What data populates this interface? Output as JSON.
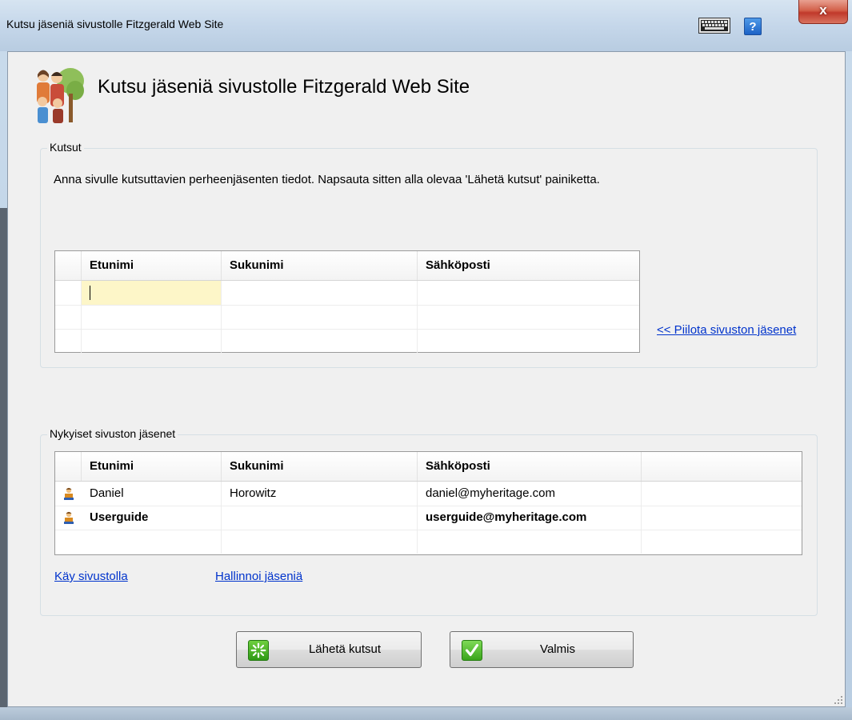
{
  "window": {
    "title": "Kutsu jäseniä sivustolle Fitzgerald Web Site",
    "help_label": "?",
    "close_label": "x"
  },
  "header": {
    "title": "Kutsu jäseniä sivustolle Fitzgerald Web Site"
  },
  "invitations": {
    "legend": "Kutsut",
    "description": "Anna sivulle kutsuttavien perheenjäsenten tiedot. Napsauta sitten alla olevaa 'Lähetä kutsut' painiketta.",
    "columns": [
      "Etunimi",
      "Sukunimi",
      "Sähköposti"
    ],
    "rows": [
      {
        "first": "",
        "last": "",
        "email": ""
      },
      {
        "first": "",
        "last": "",
        "email": ""
      },
      {
        "first": "",
        "last": "",
        "email": ""
      }
    ],
    "hide_members_link": "<< Piilota sivuston jäsenet"
  },
  "members": {
    "legend": "Nykyiset sivuston jäsenet",
    "columns": [
      "Etunimi",
      "Sukunimi",
      "Sähköposti"
    ],
    "rows": [
      {
        "first": "Daniel",
        "last": "Horowitz",
        "email": "daniel@myheritage.com",
        "bold": false
      },
      {
        "first": "Userguide",
        "last": "",
        "email": "userguide@myheritage.com",
        "bold": true
      }
    ],
    "visit_site_link": "Käy sivustolla",
    "manage_members_link": "Hallinnoi jäseniä"
  },
  "buttons": {
    "send_label": "Lähetä kutsut",
    "done_label": "Valmis"
  }
}
